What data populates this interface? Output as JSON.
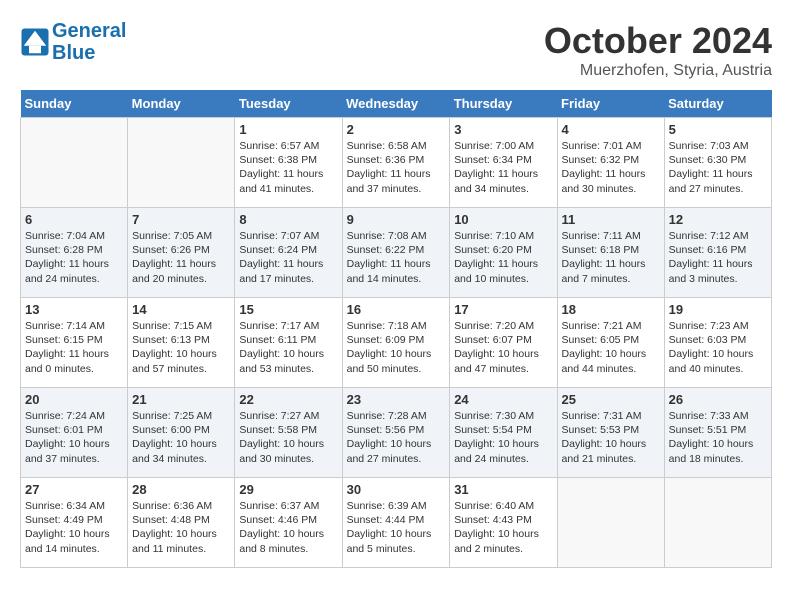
{
  "header": {
    "logo_line1": "General",
    "logo_line2": "Blue",
    "month": "October 2024",
    "location": "Muerzhofen, Styria, Austria"
  },
  "weekdays": [
    "Sunday",
    "Monday",
    "Tuesday",
    "Wednesday",
    "Thursday",
    "Friday",
    "Saturday"
  ],
  "weeks": [
    [
      {
        "num": "",
        "detail": ""
      },
      {
        "num": "",
        "detail": ""
      },
      {
        "num": "1",
        "detail": "Sunrise: 6:57 AM\nSunset: 6:38 PM\nDaylight: 11 hours and 41 minutes."
      },
      {
        "num": "2",
        "detail": "Sunrise: 6:58 AM\nSunset: 6:36 PM\nDaylight: 11 hours and 37 minutes."
      },
      {
        "num": "3",
        "detail": "Sunrise: 7:00 AM\nSunset: 6:34 PM\nDaylight: 11 hours and 34 minutes."
      },
      {
        "num": "4",
        "detail": "Sunrise: 7:01 AM\nSunset: 6:32 PM\nDaylight: 11 hours and 30 minutes."
      },
      {
        "num": "5",
        "detail": "Sunrise: 7:03 AM\nSunset: 6:30 PM\nDaylight: 11 hours and 27 minutes."
      }
    ],
    [
      {
        "num": "6",
        "detail": "Sunrise: 7:04 AM\nSunset: 6:28 PM\nDaylight: 11 hours and 24 minutes."
      },
      {
        "num": "7",
        "detail": "Sunrise: 7:05 AM\nSunset: 6:26 PM\nDaylight: 11 hours and 20 minutes."
      },
      {
        "num": "8",
        "detail": "Sunrise: 7:07 AM\nSunset: 6:24 PM\nDaylight: 11 hours and 17 minutes."
      },
      {
        "num": "9",
        "detail": "Sunrise: 7:08 AM\nSunset: 6:22 PM\nDaylight: 11 hours and 14 minutes."
      },
      {
        "num": "10",
        "detail": "Sunrise: 7:10 AM\nSunset: 6:20 PM\nDaylight: 11 hours and 10 minutes."
      },
      {
        "num": "11",
        "detail": "Sunrise: 7:11 AM\nSunset: 6:18 PM\nDaylight: 11 hours and 7 minutes."
      },
      {
        "num": "12",
        "detail": "Sunrise: 7:12 AM\nSunset: 6:16 PM\nDaylight: 11 hours and 3 minutes."
      }
    ],
    [
      {
        "num": "13",
        "detail": "Sunrise: 7:14 AM\nSunset: 6:15 PM\nDaylight: 11 hours and 0 minutes."
      },
      {
        "num": "14",
        "detail": "Sunrise: 7:15 AM\nSunset: 6:13 PM\nDaylight: 10 hours and 57 minutes."
      },
      {
        "num": "15",
        "detail": "Sunrise: 7:17 AM\nSunset: 6:11 PM\nDaylight: 10 hours and 53 minutes."
      },
      {
        "num": "16",
        "detail": "Sunrise: 7:18 AM\nSunset: 6:09 PM\nDaylight: 10 hours and 50 minutes."
      },
      {
        "num": "17",
        "detail": "Sunrise: 7:20 AM\nSunset: 6:07 PM\nDaylight: 10 hours and 47 minutes."
      },
      {
        "num": "18",
        "detail": "Sunrise: 7:21 AM\nSunset: 6:05 PM\nDaylight: 10 hours and 44 minutes."
      },
      {
        "num": "19",
        "detail": "Sunrise: 7:23 AM\nSunset: 6:03 PM\nDaylight: 10 hours and 40 minutes."
      }
    ],
    [
      {
        "num": "20",
        "detail": "Sunrise: 7:24 AM\nSunset: 6:01 PM\nDaylight: 10 hours and 37 minutes."
      },
      {
        "num": "21",
        "detail": "Sunrise: 7:25 AM\nSunset: 6:00 PM\nDaylight: 10 hours and 34 minutes."
      },
      {
        "num": "22",
        "detail": "Sunrise: 7:27 AM\nSunset: 5:58 PM\nDaylight: 10 hours and 30 minutes."
      },
      {
        "num": "23",
        "detail": "Sunrise: 7:28 AM\nSunset: 5:56 PM\nDaylight: 10 hours and 27 minutes."
      },
      {
        "num": "24",
        "detail": "Sunrise: 7:30 AM\nSunset: 5:54 PM\nDaylight: 10 hours and 24 minutes."
      },
      {
        "num": "25",
        "detail": "Sunrise: 7:31 AM\nSunset: 5:53 PM\nDaylight: 10 hours and 21 minutes."
      },
      {
        "num": "26",
        "detail": "Sunrise: 7:33 AM\nSunset: 5:51 PM\nDaylight: 10 hours and 18 minutes."
      }
    ],
    [
      {
        "num": "27",
        "detail": "Sunrise: 6:34 AM\nSunset: 4:49 PM\nDaylight: 10 hours and 14 minutes."
      },
      {
        "num": "28",
        "detail": "Sunrise: 6:36 AM\nSunset: 4:48 PM\nDaylight: 10 hours and 11 minutes."
      },
      {
        "num": "29",
        "detail": "Sunrise: 6:37 AM\nSunset: 4:46 PM\nDaylight: 10 hours and 8 minutes."
      },
      {
        "num": "30",
        "detail": "Sunrise: 6:39 AM\nSunset: 4:44 PM\nDaylight: 10 hours and 5 minutes."
      },
      {
        "num": "31",
        "detail": "Sunrise: 6:40 AM\nSunset: 4:43 PM\nDaylight: 10 hours and 2 minutes."
      },
      {
        "num": "",
        "detail": ""
      },
      {
        "num": "",
        "detail": ""
      }
    ]
  ]
}
